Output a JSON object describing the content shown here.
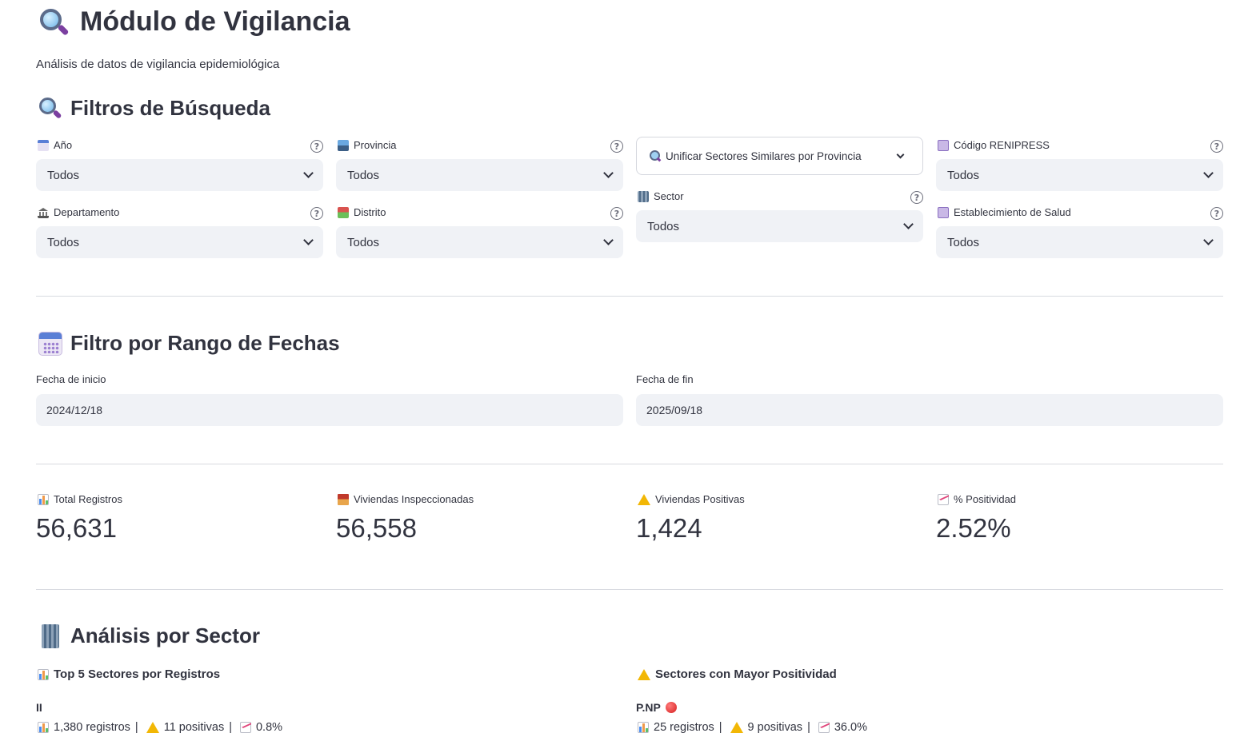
{
  "header": {
    "title": "Módulo de Vigilancia",
    "subtitle": "Análisis de datos de vigilancia epidemiológica"
  },
  "filters": {
    "section_title": "Filtros de Búsqueda",
    "anio": {
      "label": "Año",
      "value": "Todos",
      "icon": "calendar-icon"
    },
    "departamento": {
      "label": "Departamento",
      "value": "Todos",
      "icon": "museum-icon"
    },
    "provincia": {
      "label": "Provincia",
      "value": "Todos",
      "icon": "cityscape-icon"
    },
    "distrito": {
      "label": "Distrito",
      "value": "Todos",
      "icon": "houses-icon"
    },
    "unificar": {
      "label": "Unificar Sectores Similares por Provincia",
      "icon": "search-icon"
    },
    "sector": {
      "label": "Sector",
      "value": "Todos",
      "icon": "building-icon"
    },
    "renipress": {
      "label": "Código RENIPRESS",
      "value": "Todos",
      "icon": "hospital-icon"
    },
    "establecimiento": {
      "label": "Establecimiento de Salud",
      "value": "Todos",
      "icon": "hospital-icon"
    },
    "help_symbol": "?"
  },
  "date_range": {
    "section_title": "Filtro por Rango de Fechas",
    "start": {
      "label": "Fecha de inicio",
      "value": "2024/12/18"
    },
    "end": {
      "label": "Fecha de fin",
      "value": "2025/09/18"
    }
  },
  "metrics": [
    {
      "label": "Total Registros",
      "value": "56,631",
      "icon": "bar-chart-icon"
    },
    {
      "label": "Viviendas Inspeccionadas",
      "value": "56,558",
      "icon": "house-icon"
    },
    {
      "label": "Viviendas Positivas",
      "value": "1,424",
      "icon": "warning-icon"
    },
    {
      "label": "% Positividad",
      "value": "2.52%",
      "icon": "trend-icon"
    }
  ],
  "sector_analysis": {
    "section_title": "Análisis por Sector",
    "top_title": "Top 5 Sectores por Registros",
    "positivity_title": "Sectores con Mayor Positividad",
    "top_items": [
      {
        "name": "II",
        "registros": "1,380 registros",
        "positivas": "11 positivas",
        "pct": "0.8%"
      }
    ],
    "positivity_items": [
      {
        "name": "P.NP",
        "registros": "25 registros",
        "positivas": "9 positivas",
        "pct": "36.0%"
      }
    ],
    "separator": "|"
  }
}
